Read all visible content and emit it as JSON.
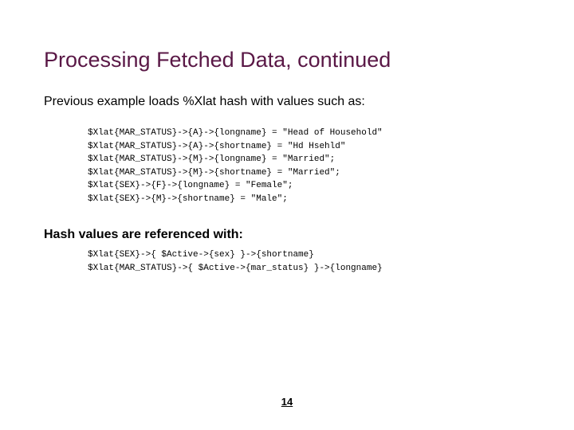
{
  "title": "Processing Fetched Data, continued",
  "subtitle": "Previous example loads %Xlat hash with values such as:",
  "code1": "$Xlat{MAR_STATUS}->{A}->{longname} = \"Head of Household\"\n$Xlat{MAR_STATUS}->{A}->{shortname} = \"Hd Hsehld\"\n$Xlat{MAR_STATUS}->{M}->{longname} = \"Married\";\n$Xlat{MAR_STATUS}->{M}->{shortname} = \"Married\";\n$Xlat{SEX}->{F}->{longname} = \"Female\";\n$Xlat{SEX}->{M}->{shortname} = \"Male\";",
  "subtitle2": "Hash values are referenced with:",
  "code2": "$Xlat{SEX}->{ $Active->{sex} }->{shortname}\n$Xlat{MAR_STATUS}->{ $Active->{mar_status} }->{longname}",
  "page": "14"
}
